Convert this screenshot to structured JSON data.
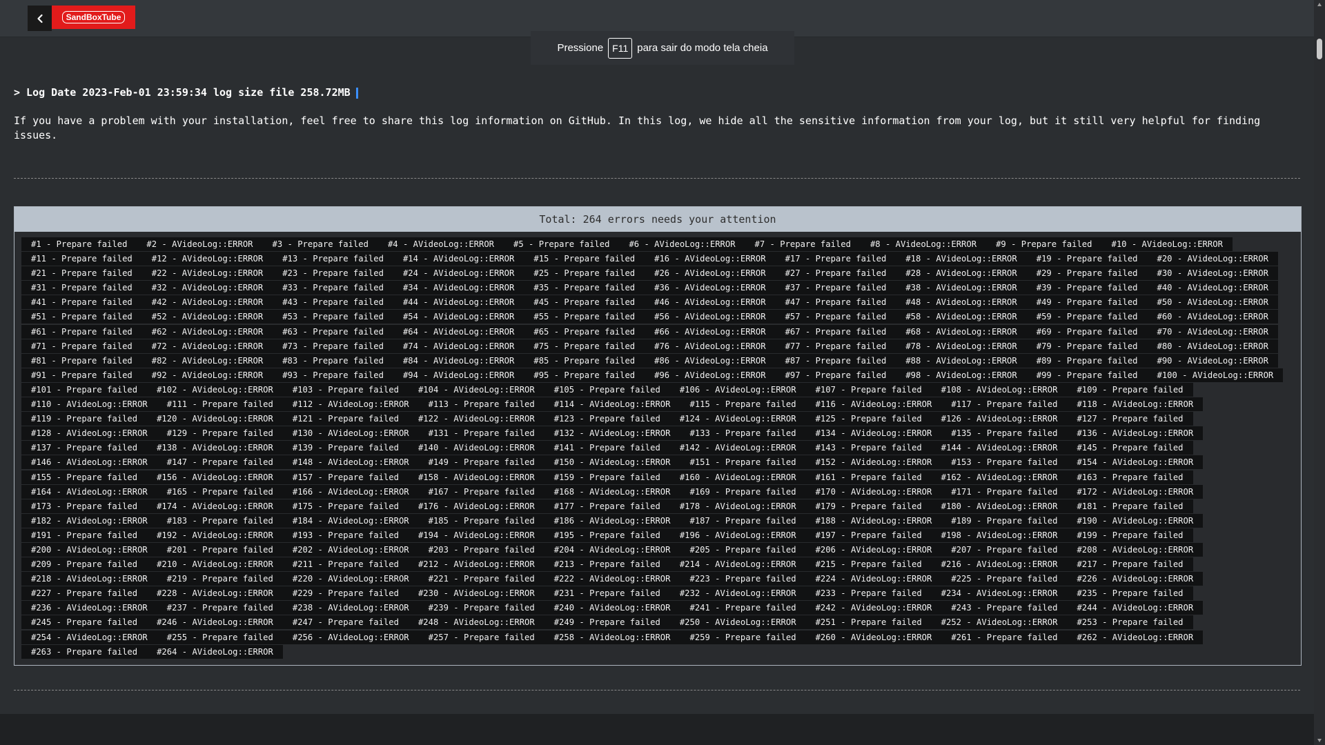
{
  "app": {
    "logo_text": "SandBoxTube",
    "back_icon": "chevron-left-icon"
  },
  "fullscreen_toast": {
    "prefix": "Pressione",
    "key": "F11",
    "suffix": "para sair do modo tela cheia"
  },
  "log": {
    "header": "> Log Date 2023-Feb-01 23:59:34 log size file 258.72MB",
    "intro": "If you have a problem with your installation, feel free to share this log information on GitHub. In this log, we hide all the sensitive information from your log, but it still very helpful for finding issues.",
    "total_label": "Total: 264 errors needs your attention",
    "total_errors": 264,
    "error_types": [
      "Prepare failed",
      "AVideoLog::ERROR"
    ],
    "row_sizes": [
      10,
      10,
      10,
      10,
      10,
      10,
      10,
      10,
      10,
      10,
      9,
      9,
      9,
      9,
      9,
      9,
      9,
      9,
      9,
      9,
      9,
      9,
      9,
      9,
      9,
      9,
      9,
      9,
      2
    ]
  },
  "colors": {
    "accent": "#e21b1b",
    "cursor": "#3b8fff",
    "panel_header": "#b9c2cc"
  }
}
